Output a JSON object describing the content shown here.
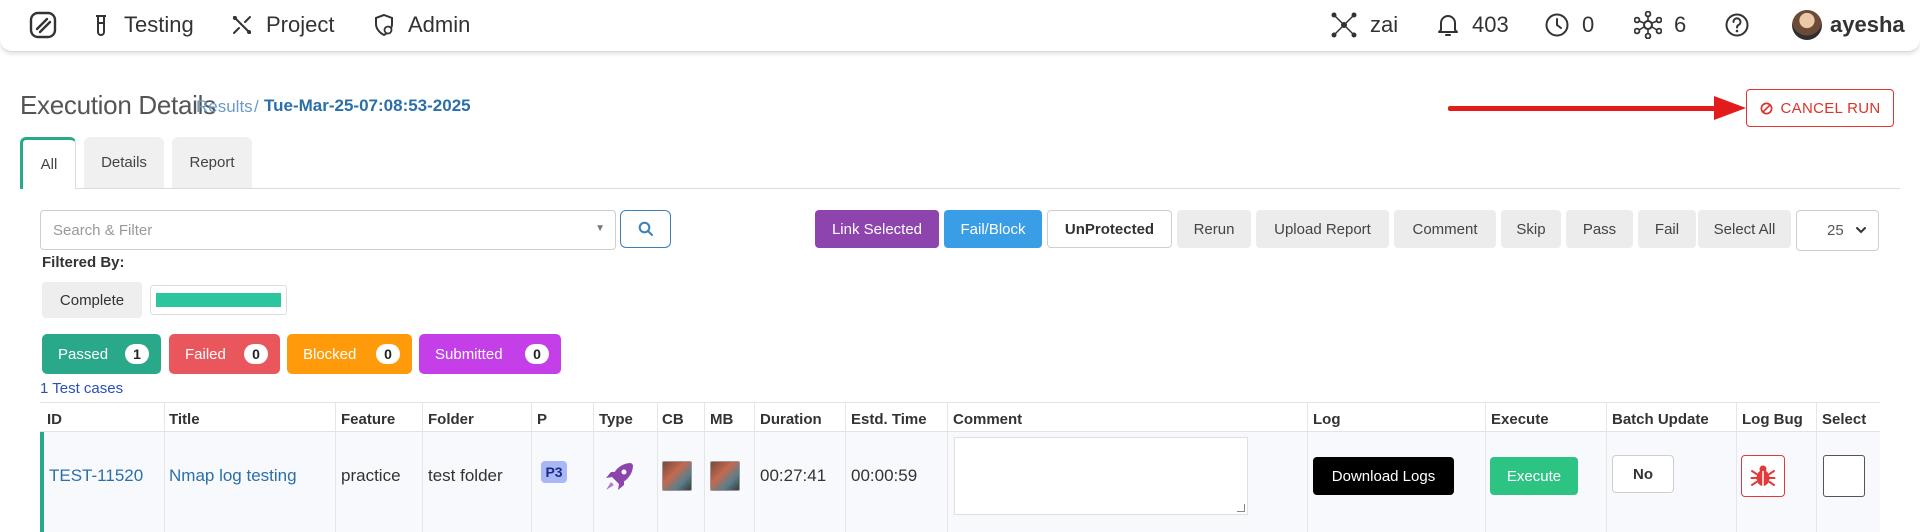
{
  "nav": {
    "testing": "Testing",
    "project": "Project",
    "admin": "Admin",
    "zai": "zai",
    "notifications": "403",
    "clock_count": "0",
    "nodes_count": "6",
    "user": "ayesha"
  },
  "header": {
    "title": "Execution Details",
    "crumb_results": "Results",
    "crumb_sep": "/",
    "run_name": "Tue-Mar-25-07:08:53-2025",
    "cancel_label": "CANCEL RUN"
  },
  "tabs": [
    {
      "label": "All"
    },
    {
      "label": "Details"
    },
    {
      "label": "Report"
    }
  ],
  "search": {
    "placeholder": "Search & Filter"
  },
  "actions": {
    "link_selected": "Link Selected",
    "fail_block": "Fail/Block",
    "unprotected": "UnProtected",
    "rerun": "Rerun",
    "upload_report": "Upload Report",
    "comment": "Comment",
    "skip": "Skip",
    "pass": "Pass",
    "fail": "Fail",
    "select_all": "Select All",
    "page_size": "25"
  },
  "filters": {
    "label": "Filtered By:",
    "complete": "Complete",
    "progress_fraction": 1.0
  },
  "status_counts": [
    {
      "label": "Passed",
      "count": "1",
      "color": "#2aa98a"
    },
    {
      "label": "Failed",
      "count": "0",
      "color": "#e9575d"
    },
    {
      "label": "Blocked",
      "count": "0",
      "color": "#ff9b0a"
    },
    {
      "label": "Submitted",
      "count": "0",
      "color": "#c43fe8"
    }
  ],
  "test_count": "1 Test cases",
  "table": {
    "columns": [
      "ID",
      "Title",
      "Feature",
      "Folder",
      "P",
      "Type",
      "CB",
      "MB",
      "Duration",
      "Estd. Time",
      "Comment",
      "Log",
      "Execute",
      "Batch Update",
      "Log Bug",
      "Select"
    ],
    "rows": [
      {
        "id": "TEST-11520",
        "title": "Nmap log testing",
        "feature": "practice",
        "folder": "test folder",
        "priority": "P3",
        "type_icon": "rocket-icon",
        "duration": "00:27:41",
        "estd_time": "00:00:59",
        "comment": "",
        "log_label": "Download Logs",
        "execute_label": "Execute",
        "batch_update": "No"
      }
    ]
  },
  "colors": {
    "accent": "#2aa98a",
    "link": "#2a6fa8",
    "cancel": "#d9342c",
    "purple": "#8e44ad",
    "blue": "#3a9ee6"
  }
}
